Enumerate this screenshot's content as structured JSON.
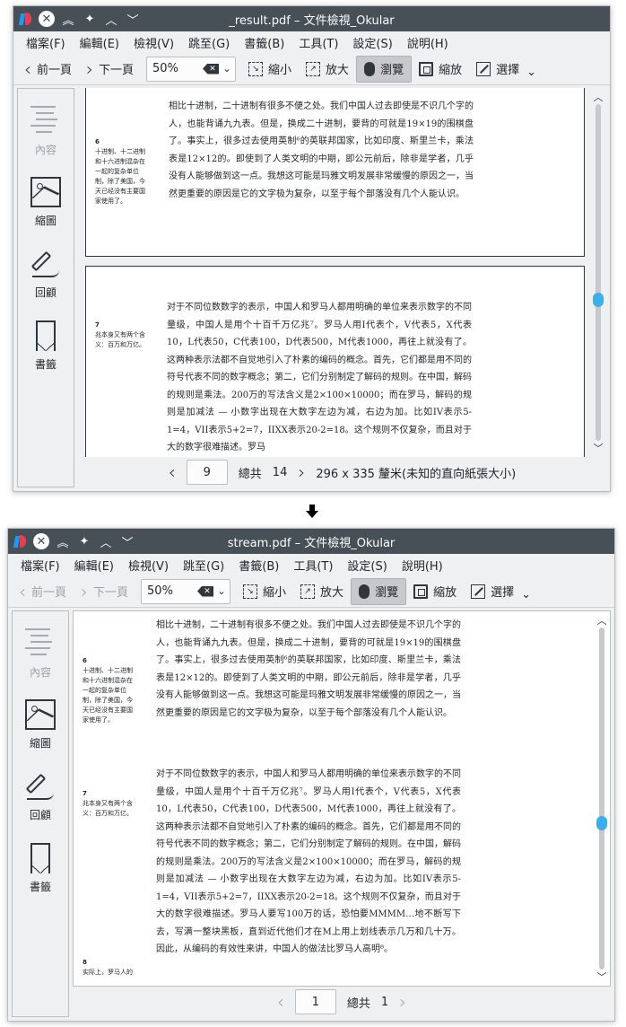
{
  "menu": [
    "檔案(F)",
    "編輯(E)",
    "檢視(V)",
    "跳至(G)",
    "書籤(B)",
    "工具(T)",
    "設定(S)",
    "說明(H)"
  ],
  "toolbar": {
    "prev_label": "前一頁",
    "next_label": "下一頁",
    "zoom_value": "50%",
    "zoom_out_label": "縮小",
    "zoom_in_label": "放大",
    "browse_label": "瀏覽",
    "zoom_mode_label": "縮放",
    "select_label": "選擇"
  },
  "sidebar": {
    "contents": "內容",
    "thumbnails": "縮圖",
    "review": "回顧",
    "bookmarks": "書籤"
  },
  "doc": {
    "note6_num": "6",
    "note6_text": "十进制、十二进制和十六进制混杂在一起的复杂单位制，除了美国，今天已经没有主要国家使用了。",
    "para1": "相比十进制，二十进制有很多不便之处。我们中国人过去即使是不识几个字的人，也能背诵九九表。但是，换成二十进制，要背的可就是19×19的围棋盘了。事实上，很多过去使用英制⁶的英联邦国家，比如印度、斯里兰卡，乘法表是12×12的。即使到了人类文明的中期，即公元前后，除非是学者，几乎没有人能够做到这一点。我想这可能是玛雅文明发展非常缓慢的原因之一，当然更重要的原因是它的文字极为复杂，以至于每个部落没有几个人能认识。",
    "note7_num": "7",
    "note7_text": "兆本身又有两个含义：百万和万亿。",
    "para2_top": "对于不同位数数字的表示，中国人和罗马人都用明确的单位来表示数字的不同量级，中国人是用个十百千万亿兆⁷。罗马人用I代表个，V代表5，X代表10，L代表50，C代表100，D代表500，M代表1000，再往上就没有了。这两种表示法都不自觉地引入了朴素的编码的概念。首先，它们都是用不同的符号代表不同的数字概念；第二，它们分别制定了解码的规则。在中国，解码的规则是乘法。200万的写法含义是2×100×10000；而在罗马，解码的规则是加减法 — 小数字出现在大数字左边为减，右边为加。比如IV表示5-1=4，VII表示5+2=7，IIXX表示20-2=18。这个规则不仅复杂，而且对于大的数字很难描述。罗马",
    "para2_bottom": "对于不同位数数字的表示，中国人和罗马人都用明确的单位来表示数字的不同量级，中国人是用个十百千万亿兆⁷。罗马人用I代表个，V代表5，X代表10，L代表50，C代表100，D代表500，M代表1000，再往上就没有了。这两种表示法都不自觉地引入了朴素的编码的概念。首先，它们都是用不同的符号代表不同的数字概念；第二，它们分别制定了解码的规则。在中国，解码的规则是乘法。200万的写法含义是2×100×10000；而在罗马，解码的规则是加减法 — 小数字出现在大数字左边为减，右边为加。比如IV表示5-1=4，VII表示5+2=7，IIXX表示20-2=18。这个规则不仅复杂，而且对于大的数字很难描述。罗马人要写100万的话，恐怕要MMMM…地不断写下去，写满一整块黑板，直到近代他们才在M上用上划线表示几万和几十万。因此，从编码的有效性来讲，中国人的做法比罗马人高明⁸。",
    "note8_num": "8",
    "note8_text": "实际上，罗马人的"
  },
  "top_window": {
    "title": "_result.pdf – 文件檢視_Okular",
    "page_current": "9",
    "total_label": "總共",
    "total_pages": "14",
    "page_size": "296 x 335 釐米(未知的直向紙張大小)"
  },
  "bottom_window": {
    "title": "stream.pdf – 文件檢視_Okular",
    "page_current": "1",
    "total_label": "總共",
    "total_pages": "1"
  },
  "colors": {
    "accent": "#3daee9",
    "titlebar": "#475057"
  }
}
